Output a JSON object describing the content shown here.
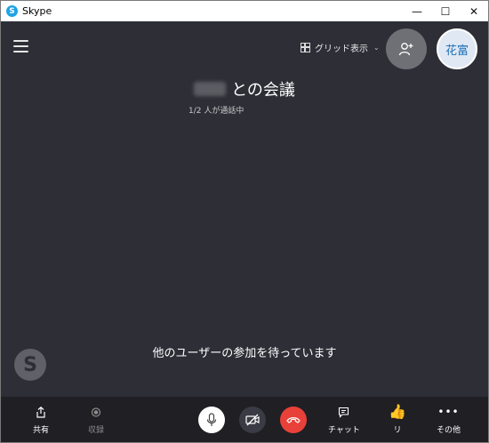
{
  "window": {
    "title": "Skype",
    "app_icon": "S"
  },
  "window_controls": {
    "minimize": "—",
    "maximize": "☐",
    "close": "✕"
  },
  "header": {
    "grid_view_label": "グリッド表示",
    "avatar_initials": "花富"
  },
  "meeting": {
    "title_suffix": "との会議",
    "participants": "1/2 人が通話中",
    "waiting_message": "他のユーザーの参加を待っています"
  },
  "toolbar": {
    "share_label": "共有",
    "record_label": "収録",
    "chat_label": "チャット",
    "react_label": "リ",
    "more_label": "その他"
  },
  "colors": {
    "call_background": "#2d2e36",
    "toolbar_background": "#1f1f24",
    "hangup": "#e8413a",
    "skype_blue": "#1fa3e6"
  }
}
